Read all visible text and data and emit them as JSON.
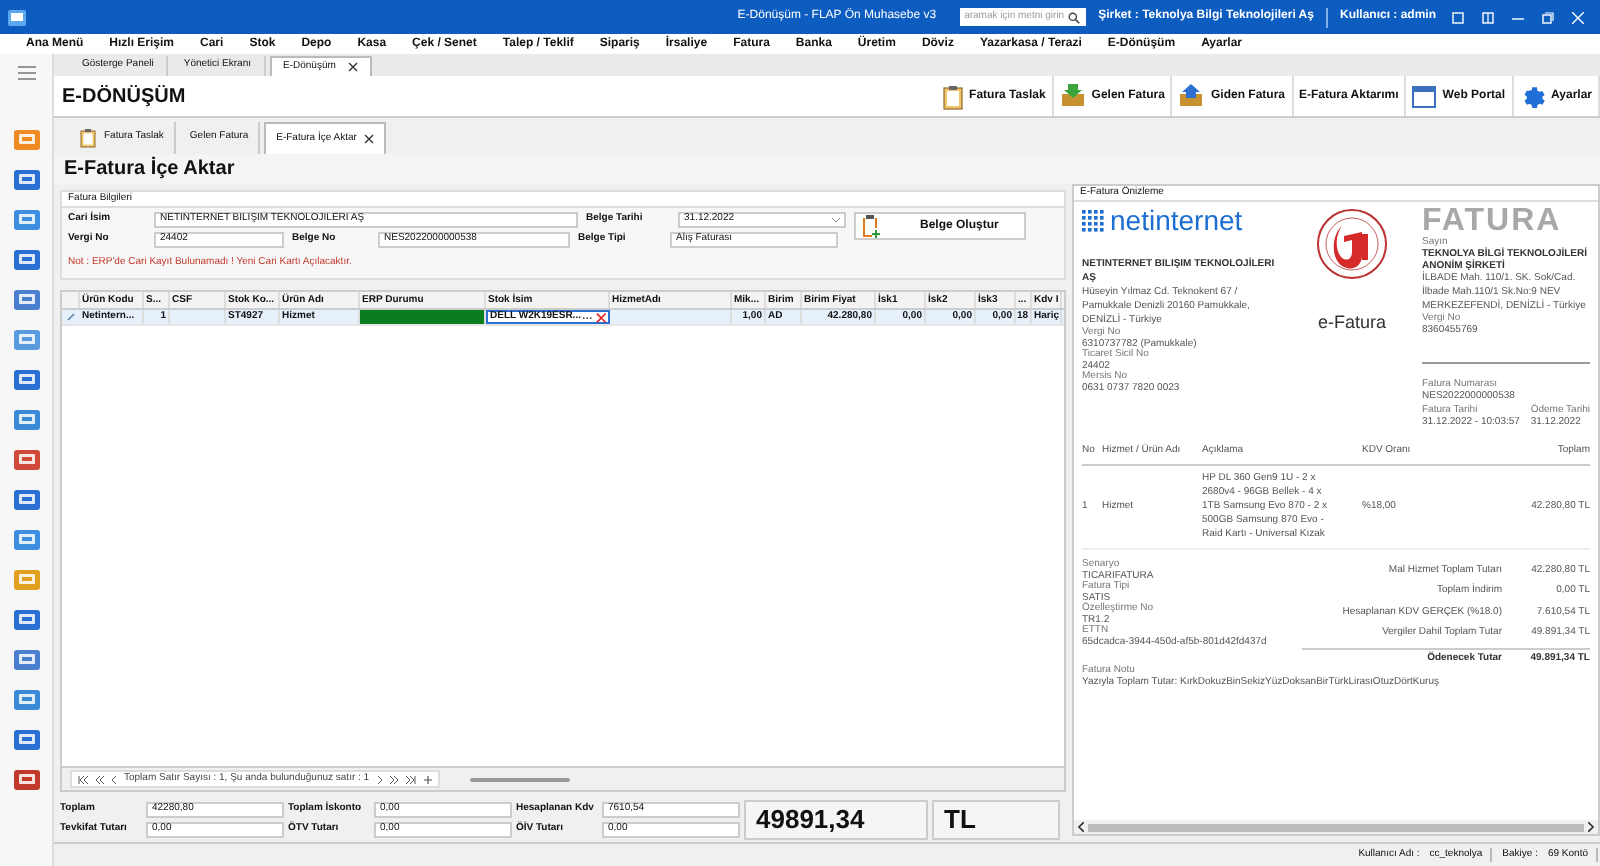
{
  "title_bar": {
    "title": "E-Dönüşüm - FLAP Ön Muhasebe v3",
    "search_placeholder": "aramak için metni girin",
    "company": "Şirket : Teknolya Bilgi Teknolojileri Aş",
    "user": "Kullanıcı : admin"
  },
  "menu": [
    "Ana Menü",
    "Hızlı Erişim",
    "Cari",
    "Stok",
    "Depo",
    "Kasa",
    "Çek / Senet",
    "Talep / Teklif",
    "Sipariş",
    "İrsaliye",
    "Fatura",
    "Banka",
    "Üretim",
    "Döviz",
    "Yazarkasa / Terazi",
    "E-Dönüşüm",
    "Ayarlar"
  ],
  "tabs": [
    {
      "label": "Gösterge Paneli",
      "selected": false,
      "closable": false
    },
    {
      "label": "Yönetici Ekranı",
      "selected": false,
      "closable": false
    },
    {
      "label": "E-Dönüşüm",
      "selected": true,
      "closable": true
    }
  ],
  "module": {
    "title": "E-DÖNÜŞÜM",
    "toolbar": [
      {
        "label": "Fatura Taslak",
        "kind": "clipboard"
      },
      {
        "label": "Gelen Fatura",
        "kind": "inbox"
      },
      {
        "label": "Giden Fatura",
        "kind": "outbox"
      },
      {
        "label": "E-Fatura Aktarımı",
        "kind": "none"
      },
      {
        "label": "Web Portal",
        "kind": "window"
      },
      {
        "label": "Ayarlar",
        "kind": "gear"
      }
    ]
  },
  "subtabs": [
    {
      "label": "Fatura Taslak",
      "selected": false,
      "closable": false,
      "icon": true
    },
    {
      "label": "Gelen Fatura",
      "selected": false,
      "closable": false,
      "icon": false
    },
    {
      "label": "E-Fatura İçe Aktar",
      "selected": true,
      "closable": true,
      "icon": false
    }
  ],
  "page_title": "E-Fatura İçe Aktar",
  "form": {
    "section": "Fatura Bilgileri",
    "cari_label": "Cari İsim",
    "cari_value": "NETINTERNET BILIŞIM TEKNOLOJILERI AŞ",
    "vergi_label": "Vergi No",
    "vergi_value": "24402",
    "belge_no_label": "Belge No",
    "belge_no_value": "NES2022000000538",
    "tarih_label": "Belge Tarihi",
    "tarih_value": "31.12.2022",
    "tip_label": "Belge Tipi",
    "tip_value": "Alış Faturası",
    "create_button": "Belge Oluştur",
    "warning": "Not : ERP'de Cari Kayıt Bulunamadı ! Yeni Cari Kartı Açılacaktır."
  },
  "table": {
    "columns": [
      "Ürün Kodu",
      "S...",
      "CSF",
      "Stok Ko...",
      "Ürün Adı",
      "ERP Durumu",
      "Stok İsim",
      "HizmetAdı",
      "Mik...",
      "Birim",
      "Birim Fiyat",
      "İsk1",
      "İsk2",
      "İsk3",
      "...",
      "Kdv I"
    ],
    "rows": [
      {
        "selected": true,
        "color": "#0a7d1f",
        "cells": [
          "Netintern...",
          "1",
          "",
          "ST4927",
          "Hizmet",
          "",
          "DELL W2K19ESR...",
          "",
          "1,00",
          "AD",
          "42.280,80",
          "0,00",
          "0,00",
          "0,00",
          "18",
          "Hariç"
        ]
      }
    ]
  },
  "pagination": "Toplam Satır Sayısı : 1, Şu anda bulunduğunuz satır : 1",
  "totals": [
    {
      "label": "Toplam",
      "value": "42280,80"
    },
    {
      "label": "Toplam İskonto",
      "value": "0,00"
    },
    {
      "label": "Hesaplanan Kdv",
      "value": "7610,54"
    },
    {
      "label": "Tevkifat Tutarı",
      "value": "0,00"
    },
    {
      "label": "ÖTV Tutarı",
      "value": "0,00"
    },
    {
      "label": "ÖİV Tutarı",
      "value": "0,00"
    }
  ],
  "grand_total": "49891,34",
  "currency": "TL",
  "preview": {
    "header": "E-Fatura Önizleme",
    "brand": "netinternet",
    "efatura": "e-Fatura",
    "doc_title": "FATURA",
    "seller_name": "NETINTERNET BILIŞIM TEKNOLOJİLERI AŞ",
    "seller_address": "Hüseyin Yılmaz Cd. Teknokent 67 / Pamukkale Denizli 20160 Pamukkale, DENİZLİ - Türkiye",
    "seller_fields": [
      {
        "label": "Vergi No",
        "value": "6310737782 (Pamukkale)"
      },
      {
        "label": "Ticaret Sicil No",
        "value": "24402"
      },
      {
        "label": "Mersis No",
        "value": "0631 0737 7820 0023"
      }
    ],
    "buyer_label": "Sayın",
    "buyer_name": "TEKNOLYA BİLGİ TEKNOLOJİLERİ ANONİM ŞİRKETİ",
    "buyer_address": "İLBADE Mah. 110/1. SK. Sok/Cad. İlbade Mah.110/1 Sk.No:9 NEV MERKEZEFENDİ, DENİZLİ - Türkiye",
    "buyer_fields": [
      {
        "label": "Vergi No",
        "value": "8360455769"
      }
    ],
    "number_label": "Fatura Numarası",
    "number": "NES2022000000538",
    "date_label": "Fatura Tarihi",
    "date": "31.12.2022 - 10:03:57",
    "due_label": "Ödeme Tarihi",
    "due": "31.12.2022",
    "item_columns": [
      "No",
      "Hizmet / Ürün Adı",
      "Açıklama",
      "KDV Oranı",
      "Toplam"
    ],
    "items": [
      [
        "1",
        "Hizmet",
        "HP DL 360 Gen9 1U - 2 x 2680v4 - 96GB Bellek - 4 x 1TB Samsung Evo 870 - 2 x 500GB Samsung 870 Evo - Raid Kartı - Universal Kızak",
        "%18,00",
        "42.280,80 TL"
      ]
    ],
    "meta": [
      {
        "label": "Senaryo",
        "value": "TICARIFATURA"
      },
      {
        "label": "Fatura Tipi",
        "value": "SATIS"
      },
      {
        "label": "Özelleştirme No",
        "value": "TR1.2"
      },
      {
        "label": "ETTN",
        "value": "65dcadca-3944-450d-af5b-801d42fd437d"
      }
    ],
    "sums": [
      {
        "label": "Mal Hizmet Toplam Tutarı",
        "value": "42.280,80 TL",
        "bold": false
      },
      {
        "label": "Toplam İndirim",
        "value": "0,00 TL",
        "bold": false
      },
      {
        "label": "Hesaplanan KDV GERÇEK (%18.0)",
        "value": "7.610,54 TL",
        "bold": false
      },
      {
        "label": "Vergiler Dahil Toplam Tutar",
        "value": "49.891,34 TL",
        "bold": false
      },
      {
        "label": "Ödenecek Tutar",
        "value": "49.891,34 TL",
        "bold": true
      }
    ],
    "note_label": "Fatura Notu",
    "note": "Yazıyla Toplam Tutar: KırkDokuzBinSekizYüzDoksanBirTürkLirasıOtuzDörtKuruş"
  },
  "status": [
    {
      "label": "Kullanıcı Adı :",
      "value": "cc_teknolya"
    },
    {
      "label": "Bakiye :",
      "value": "69 Kontö"
    }
  ]
}
